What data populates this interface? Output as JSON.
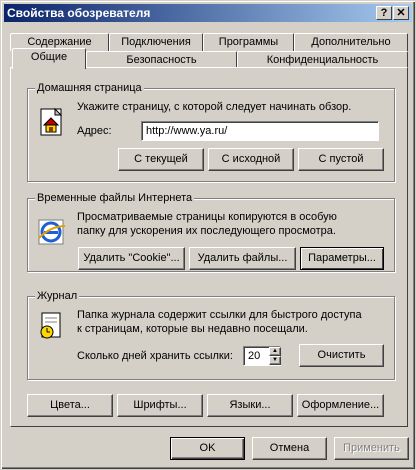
{
  "window": {
    "title": "Свойства обозревателя",
    "help_label": "?",
    "close_label": "✕"
  },
  "tabs": {
    "row1": [
      "Содержание",
      "Подключения",
      "Программы",
      "Дополнительно"
    ],
    "row2": [
      "Общие",
      "Безопасность",
      "Конфиденциальность"
    ],
    "active": "Общие"
  },
  "home": {
    "group_label": "Домашняя страница",
    "description": "Укажите страницу, с которой следует начинать обзор.",
    "address_label": "Адрес:",
    "address_value": "http://www.ya.ru/",
    "btn_current": "С текущей",
    "btn_default": "С исходной",
    "btn_blank": "С пустой",
    "icon": "house-page-icon"
  },
  "temp": {
    "group_label": "Временные файлы Интернета",
    "description_line1": "Просматриваемые страницы копируются в особую",
    "description_line2": "папку для ускорения их последующего просмотра.",
    "btn_delete_cookies": "Удалить \"Cookie\"...",
    "btn_delete_files": "Удалить файлы...",
    "btn_settings": "Параметры...",
    "icon": "ie-temp-files-icon"
  },
  "history": {
    "group_label": "Журнал",
    "description_line1": "Папка журнала содержит ссылки для быстрого доступа",
    "description_line2": "к страницам, которые вы недавно посещали.",
    "days_label": "Сколько дней хранить ссылки:",
    "days_value": "20",
    "btn_clear": "Очистить",
    "icon": "history-icon"
  },
  "bottom_buttons": {
    "colors": "Цвета...",
    "fonts": "Шрифты...",
    "languages": "Языки...",
    "accessibility": "Оформление..."
  },
  "dialog_buttons": {
    "ok": "OK",
    "cancel": "Отмена",
    "apply": "Применить"
  }
}
